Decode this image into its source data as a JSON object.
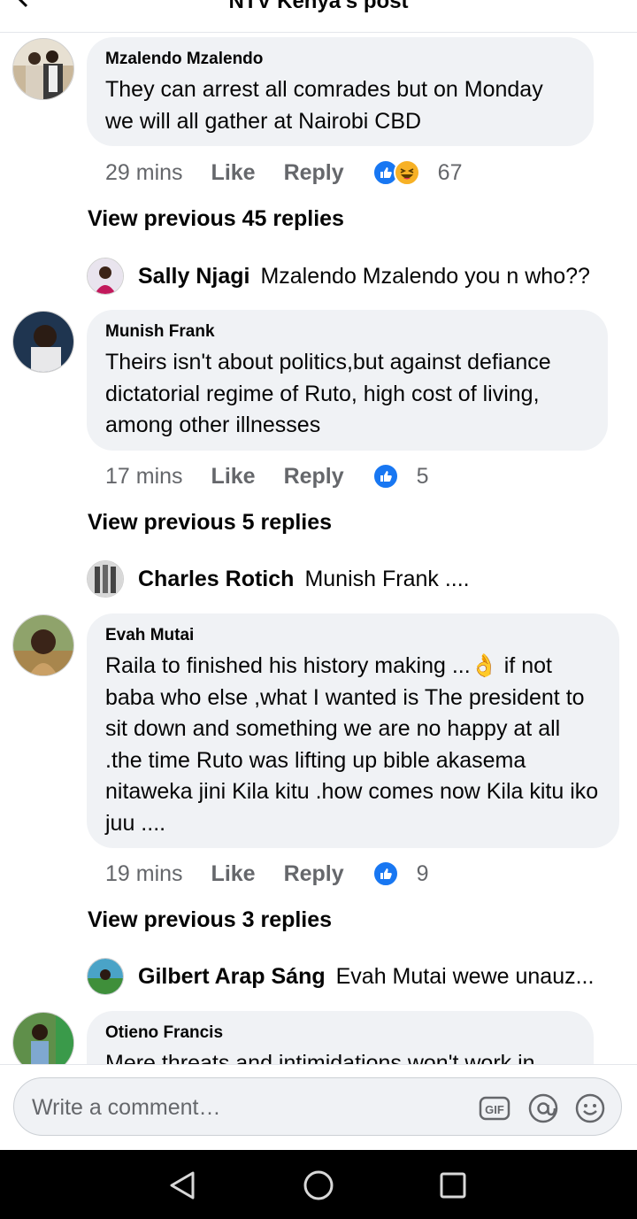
{
  "header": {
    "title": "NTV Kenya's post"
  },
  "comments": [
    {
      "author": "Mzalendo Mzalendo",
      "text": "They can arrest all comrades but on Monday we will all gather at Nairobi CBD",
      "time": "29 mins",
      "like_label": "Like",
      "reply_label": "Reply",
      "reactions": [
        "like",
        "haha"
      ],
      "reaction_count": "67",
      "view_previous": "View previous 45 replies",
      "reply_preview": {
        "author": "Sally Njagi",
        "text": "Mzalendo Mzalendo you n who??"
      }
    },
    {
      "author": "Munish Frank",
      "text": "Theirs isn't about politics,but against defiance dictatorial regime of Ruto, high cost of living, among other illnesses",
      "time": "17 mins",
      "like_label": "Like",
      "reply_label": "Reply",
      "reactions": [
        "like"
      ],
      "reaction_count": "5",
      "view_previous": "View previous 5 replies",
      "reply_preview": {
        "author": "Charles Rotich",
        "text": "Munish Frank ...."
      }
    },
    {
      "author": "Evah Mutai",
      "text": "Raila to finished his history making ...👌 if not baba who else ,what I wanted is The president to sit down and something we are no happy at all .the time Ruto was lifting up bible akasema nitaweka jini Kila kitu .how comes now Kila kitu iko juu ....",
      "time": "19 mins",
      "like_label": "Like",
      "reply_label": "Reply",
      "reactions": [
        "like"
      ],
      "reaction_count": "9",
      "view_previous": "View previous 3 replies",
      "reply_preview": {
        "author": "Gilbert Arap Sáng",
        "text": "Evah Mutai wewe unauz..."
      }
    },
    {
      "author": "Otieno Francis",
      "text": "Mere threats and intimidations won't work in"
    }
  ],
  "composer": {
    "placeholder": "Write a comment…"
  },
  "colors": {
    "like_blue": "#1877f2",
    "haha_yellow": "#f7b125",
    "bubble": "#f0f2f5",
    "meta_gray": "#65676b"
  }
}
